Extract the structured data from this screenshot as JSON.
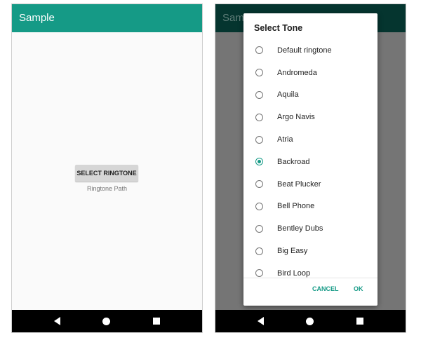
{
  "colors": {
    "accent": "#159a86",
    "toolbar_dim": "#05352f",
    "overlay": "#757575",
    "navbar": "#000000"
  },
  "left_screen": {
    "app_title": "Sample",
    "select_button_label": "SELECT RINGTONE",
    "ringtone_path_label": "Ringtone Path",
    "navbar": {
      "back_icon": "back-triangle-icon",
      "home_icon": "home-circle-icon",
      "recents_icon": "recents-square-icon"
    }
  },
  "right_screen": {
    "app_title": "Sample",
    "dialog": {
      "title": "Select Tone",
      "tones": [
        {
          "label": "Default ringtone",
          "selected": false
        },
        {
          "label": "Andromeda",
          "selected": false
        },
        {
          "label": "Aquila",
          "selected": false
        },
        {
          "label": "Argo Navis",
          "selected": false
        },
        {
          "label": "Atria",
          "selected": false
        },
        {
          "label": "Backroad",
          "selected": true
        },
        {
          "label": "Beat Plucker",
          "selected": false
        },
        {
          "label": "Bell Phone",
          "selected": false
        },
        {
          "label": "Bentley Dubs",
          "selected": false
        },
        {
          "label": "Big Easy",
          "selected": false
        },
        {
          "label": "Bird Loop",
          "selected": false
        }
      ],
      "cancel_label": "CANCEL",
      "ok_label": "OK"
    },
    "navbar": {
      "back_icon": "back-triangle-icon",
      "home_icon": "home-circle-icon",
      "recents_icon": "recents-square-icon"
    }
  }
}
